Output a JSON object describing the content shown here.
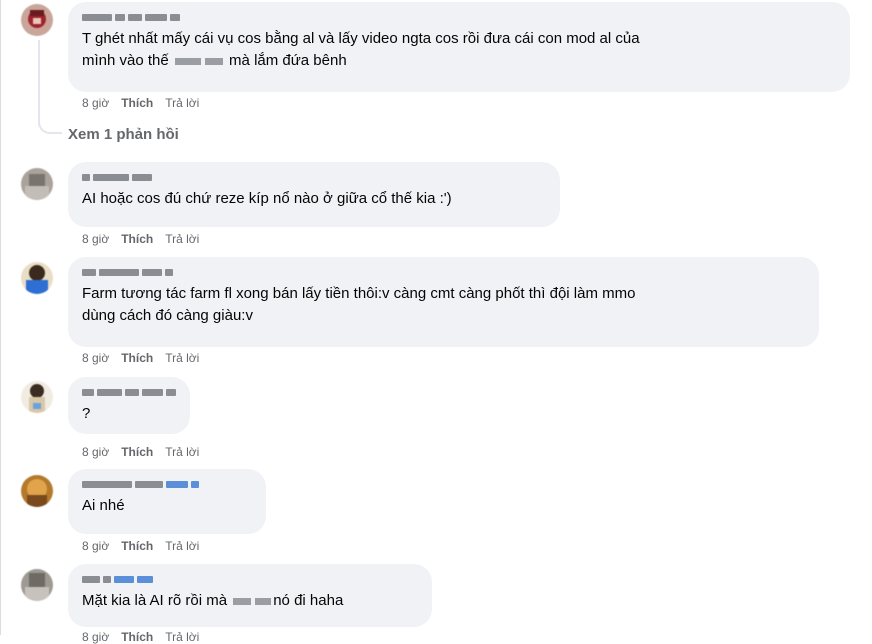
{
  "comments": [
    {
      "text_line1": "T ghét nhất mấy cái vụ cos bằng al và lấy video ngta cos rồi đưa cái con mod al của",
      "text_line2_pre": "mình vào thế ",
      "text_line2_post": " mà lắm đứa bênh",
      "time": "8 giờ",
      "like": "Thích",
      "reply": "Trả lời"
    },
    {
      "text": "AI hoặc cos đú chứ reze kíp nổ nào ở giữa cổ thế kia :')",
      "time": "8 giờ",
      "like": "Thích",
      "reply": "Trả lời"
    },
    {
      "text_line1": "Farm tương tác farm fl xong bán lấy tiền thôi:v càng cmt càng phốt thì đội làm mmo",
      "text_line2": "dùng cách đó càng giàu:v",
      "time": "8 giờ",
      "like": "Thích",
      "reply": "Trả lời"
    },
    {
      "text": "?",
      "time": "8 giờ",
      "like": "Thích",
      "reply": "Trả lời"
    },
    {
      "text": "Ai nhé",
      "time": "8 giờ",
      "like": "Thích",
      "reply": "Trả lời"
    },
    {
      "text_pre": "Mặt kia là AI rõ rồi mà ",
      "text_post": "nó đi haha",
      "time": "8 giờ",
      "like": "Thích",
      "reply": "Trả lời"
    }
  ],
  "view_replies_label": "Xem 1 phản hồi"
}
